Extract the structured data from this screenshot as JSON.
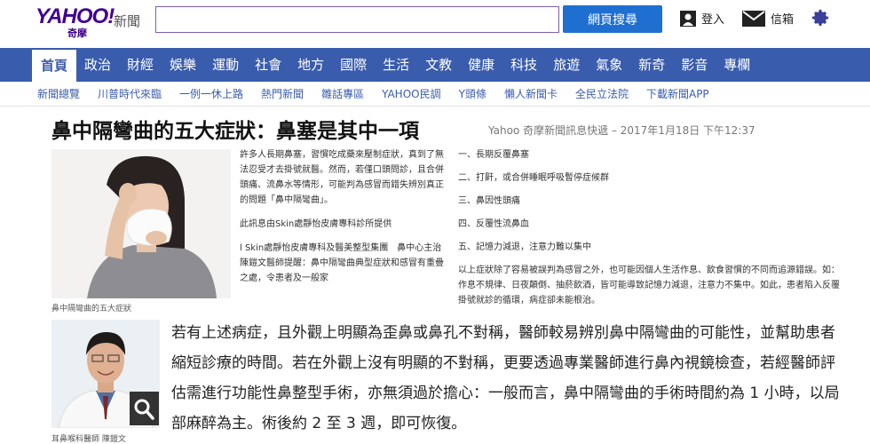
{
  "header": {
    "logo_text": "YAHOO!",
    "logo_sub": "奇摩",
    "section_label": "新聞",
    "search_value": "",
    "search_button": "網頁搜尋",
    "login_label": "登入",
    "mail_label": "信箱"
  },
  "nav": {
    "items": [
      "首頁",
      "政治",
      "財經",
      "娛樂",
      "運動",
      "社會",
      "地方",
      "國際",
      "生活",
      "文教",
      "健康",
      "科技",
      "旅遊",
      "氣象",
      "新奇",
      "影音",
      "專欄"
    ],
    "active_index": 0
  },
  "subnav": {
    "items": [
      "新聞總覽",
      "川普時代來臨",
      "一例一休上路",
      "熱門新聞",
      "雛話專區",
      "YAHOO民調",
      "Y頭條",
      "懶人新聞卡",
      "全民立法院",
      "下載新聞APP"
    ]
  },
  "article": {
    "title": "鼻中隔彎曲的五大症狀：鼻塞是其中一項",
    "byline": "Yahoo 奇摩新聞訊息快遞 – 2017年1月18日 下午12:37",
    "image1_caption": "鼻中隔彎曲的五大症狀",
    "image2_caption": "耳鼻喉科醫師 陳鎧文",
    "mid_paragraphs": [
      "許多人長期鼻塞，習慣吃成藥來壓制症狀，真到了無法忍受才去掛號就醫。然而，若僅口頭問診，且合併頭痛、流鼻水等情形，可能判為感冒而錯失辨別真正的問題「鼻中隔彎曲」。",
      "此訊息由Skin處靜怡皮膚專科診所提供",
      "l Skin處靜怡皮膚專科及醫美整型集團　鼻中心主治　陳鎧文醫師提醒：鼻中隔彎曲典型症狀和感冒有重疊之處，令患者及一般家"
    ],
    "symptoms": [
      "一、長期反覆鼻塞",
      "二、打鼾，或合併睡眠呼吸暫停症候群",
      "三、鼻因性頭痛",
      "四、反覆性流鼻血",
      "五、記憶力減退，注意力難以集中"
    ],
    "right_paragraph": "以上症狀除了容易被誤判為感冒之外，也可能因個人生活作息、飲食習慣的不同而追源錯誤。如：作息不規律、日夜顛倒、抽菸飲酒，皆可能導致記憶力減退，注意力不集中。如此，患者陷入反覆掛號就診的循環，病症卻未能根治。",
    "big_paragraph": "若有上述病症，且外觀上明顯為歪鼻或鼻孔不對稱，醫師較易辨別鼻中隔彎曲的可能性，並幫助患者縮短診療的時間。若在外觀上沒有明顯的不對稱，更要透過專業醫師進行鼻內視鏡檢查，若經醫師評估需進行功能性鼻整型手術，亦無須過於擔心：一般而言，鼻中隔彎曲的手術時間約為 1 小時，以局部麻醉為主。術後約 2 至 3 週，即可恢復。"
  },
  "colors": {
    "brand_purple": "#400090",
    "nav_blue": "#3a5cad",
    "search_blue": "#1f6fd1"
  }
}
